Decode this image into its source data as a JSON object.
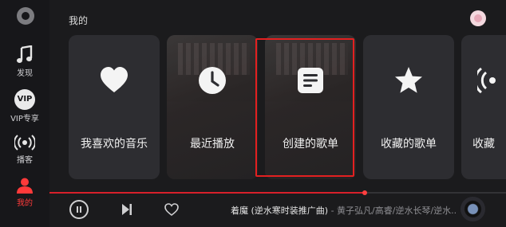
{
  "sidebar": {
    "items": [
      {
        "label": "发现",
        "icon": "music-note-icon"
      },
      {
        "label": "VIP专享",
        "icon": "vip-icon",
        "badge": "VIP"
      },
      {
        "label": "播客",
        "icon": "podcast-icon"
      },
      {
        "label": "我的",
        "icon": "person-icon",
        "active": true
      }
    ]
  },
  "page": {
    "title": "我的"
  },
  "cards": [
    {
      "label": "我喜欢的音乐",
      "icon": "heart-icon"
    },
    {
      "label": "最近播放",
      "icon": "clock-icon"
    },
    {
      "label": "创建的歌单",
      "icon": "playlist-icon"
    },
    {
      "label": "收藏的歌单",
      "icon": "star-icon"
    },
    {
      "label": "收藏",
      "icon": "podcast-icon"
    }
  ],
  "player": {
    "title": "着魔 (逆水寒时装推广曲)",
    "artist": " - 黄子弘凡/高睿/逆水长琴/逆水...",
    "progress": 0.69
  },
  "colors": {
    "accent": "#ff3a3a",
    "highlight_box": "#e32020"
  }
}
